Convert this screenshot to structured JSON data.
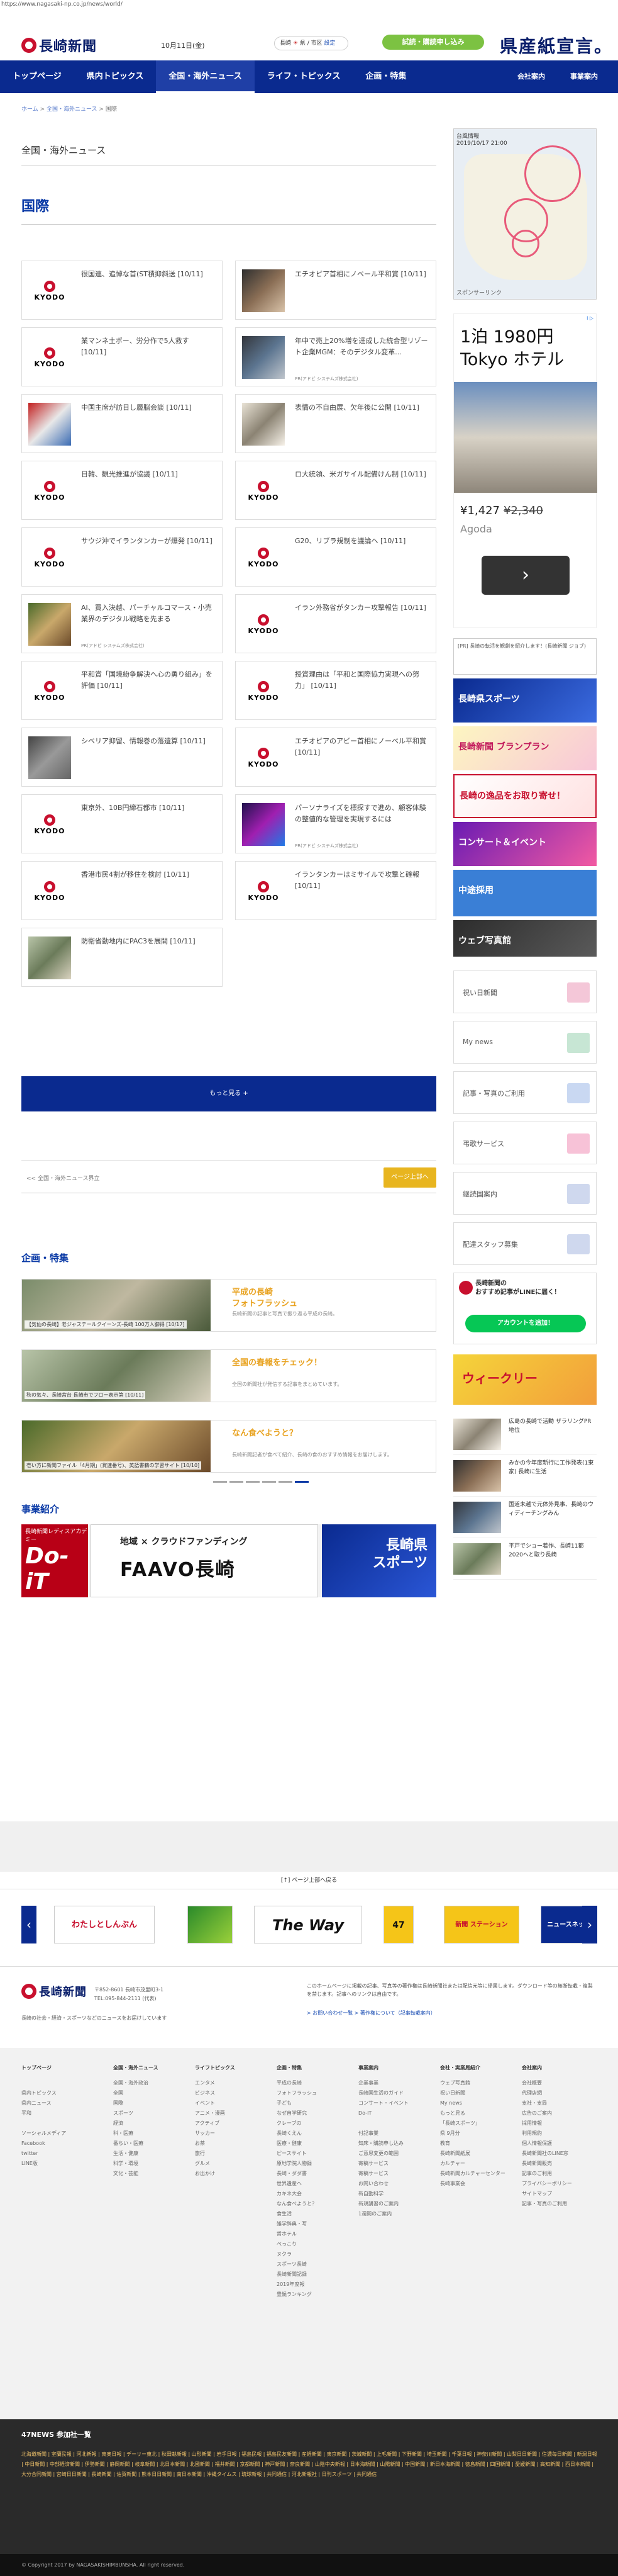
{
  "browser": {
    "url": "https://www.nagasaki-np.co.jp/news/world/"
  },
  "header": {
    "logo_text": "長崎新聞",
    "date": "10月11日(金)",
    "weather_city": "長崎",
    "weather_link": "県 / 市区",
    "weather_set": "設定",
    "subscribe_label": "試読・購読申し込み",
    "brand_banner": "県産紙宣言。"
  },
  "nav": {
    "items": [
      "トップページ",
      "県内トピックス",
      "全国・海外ニュース",
      "ライフ・トピックス",
      "企画・特集"
    ],
    "right": [
      "会社案内",
      "事業案内"
    ]
  },
  "breadcrumb": {
    "home": "ホーム",
    "parent": "全国・海外ニュース",
    "current": "国際"
  },
  "main": {
    "section": "全国・海外ニュース",
    "region": "国際",
    "articles": [
      {
        "title": "很国連、追悼な首(ST積抑斜送 [10/11]",
        "sub": ""
      },
      {
        "title": "エチオピア首相にノベール平和賞 [10/11]",
        "sub": ""
      },
      {
        "title": "業マンネ土ボー、労分作で5人救す [10/11]",
        "sub": ""
      },
      {
        "title": "年中で売上20%増を達成した統合型リゾート企業MGM：そのデジタル変革...",
        "sub": "PR(アドビ システムズ株式会社)"
      },
      {
        "title": "中国主席が訪日し層脳会談 [10/11]",
        "sub": ""
      },
      {
        "title": "表情の不自由展、欠年後に公開 [10/11]",
        "sub": ""
      },
      {
        "title": "日韓、観光推進が協議 [10/11]",
        "sub": ""
      },
      {
        "title": "ロ大統領、米ガサイル配備けん制 [10/11]",
        "sub": ""
      },
      {
        "title": "サウジ沖でイランタンカーが爆発 [10/11]",
        "sub": ""
      },
      {
        "title": "G20、リブラ規制を議論へ [10/11]",
        "sub": ""
      },
      {
        "title": "AI、買入決越、パーチャルコマース・小売業界のデジタル戦略を先まる",
        "sub": "PR(アドビ システムズ株式会社)"
      },
      {
        "title": "イラン外務省がタンカー攻撃報告 [10/11]",
        "sub": ""
      },
      {
        "title": "平和賞「国境紛争解決へ心の勇り組み」を評価 [10/11]",
        "sub": ""
      },
      {
        "title": "授賞理由は「平和と国際協力実現への努力」 [10/11]",
        "sub": ""
      },
      {
        "title": "シベリア抑留、情報巻の落遺算 [10/11]",
        "sub": ""
      },
      {
        "title": "エチオピアのアビー首相にノーベル平和賞 [10/11]",
        "sub": ""
      },
      {
        "title": "東京外、10B円締石都市 [10/11]",
        "sub": ""
      },
      {
        "title": "パーソナライズを標探すで進め、顧客体験の整値的な管理を実現するには",
        "sub": "PR(アドビ システムズ株式会社)"
      },
      {
        "title": "香港市民4割が移住を検討 [10/11]",
        "sub": ""
      },
      {
        "title": "イランタンカーはミサイルで攻撃と確報 [10/11]",
        "sub": ""
      },
      {
        "title": "防衛省勤地内にPAC3を展開 [10/11]",
        "sub": ""
      }
    ],
    "more_label": "もっと見る +",
    "pager_left": "<< 全国・海外ニュース界立",
    "pager_up": "ページ上部へ"
  },
  "features": {
    "title": "企画・特集",
    "items": [
      {
        "caption": "【気仙の長崎】老ジャステールクイーンズ-長崎 100万人御得 [10/17]",
        "title": "平成の長崎\nフォトフラッシュ",
        "desc": "長崎新聞の記事と写真で振り返る平成の長崎。"
      },
      {
        "caption": "秋の気々、長崎宮台 長崎市でフロー表示第 [10/11]",
        "title": "全国の春報をチェック！",
        "desc": "全国の新聞社が発信する記事をまとめています。"
      },
      {
        "caption": "壱い方に新聞ファイル「4月期」(賞連番号)、英語書籍の学習サイト [10/10]",
        "title": "なん食べようと？",
        "desc": "長崎新聞記者が食べて紹介、長崎の食のおすすめ情報をお届けします。"
      }
    ]
  },
  "business": {
    "title": "事業紹介",
    "doit_caption": "長崎新聞レディスアカデミー",
    "doit_big": "Do-iT",
    "faavo_line1": "地域 × クラウドファンディング",
    "faavo_line2": "FAAVO長崎",
    "sports": "長崎県\nスポーツ"
  },
  "sidebar": {
    "map_title": "台風情報",
    "map_time": "2019/10/17 21:00",
    "map_foot": "スポンサーリンク",
    "ad_line1": "1泊 1980円",
    "ad_line2": "Tokyo ホテル",
    "ad_price": "¥1,427",
    "ad_old_price": "¥2,340",
    "ad_brand": "Agoda",
    "ad_go": "›",
    "ad_choice": "i ▷",
    "side_news": "[PR] 長崎の転活を観劇を紹介します！(長崎新聞 ジョブ)",
    "banners": [
      "長崎県スポーツ",
      "長崎新聞 ブランプラン",
      "長崎の逸品をお取り寄せ！",
      "コンサート＆イベント",
      "中途採用",
      "ウェブ写真館"
    ],
    "services": [
      "祝い日新聞",
      "My news",
      "記事・写真のご利用",
      "弔歌サービス",
      "継読国案内",
      "配達スタッフ募集"
    ],
    "line_text": "長崎新聞の\nおすすめ記事がLINEに届く！",
    "line_add": "アカウントを追加！",
    "weekly": "ウィークリー",
    "side_list": [
      "広島の長崎で活動 ザラリングPR地位",
      "みかの今年度新行に工作発表(1東家) 長崎に生活",
      "国道未越で元体外見事、長崎のウィディーチングみん",
      "平戸でショー着作、長崎11都 2020へと取り長崎"
    ]
  },
  "footer": {
    "pagetop": "[↑] ページ上部へ戻る",
    "carousel": [
      "わたしとしんぶん",
      "",
      "The Way",
      "47",
      "新聞 ステーション",
      "ニュースネット"
    ],
    "address": "〒852-8601 長崎市茂里町3-1\nTEL:095-844-2111 (代表)",
    "desc": "長崎の社会・経済・スポーツなどのニュースをお届けしています",
    "notice": "このホームページに掲載の記事、写真等の著作権は長崎新聞社または配信元等に帰属します。ダウンロード等の無断転載・複製を禁じます。記事へのリンクは自由です。",
    "links": "> お問い合わせ一覧    > 著作権について（記事転載案内）",
    "columns": [
      {
        "h": "トップページ",
        "items": [
          "",
          "県内トピックス",
          "県内ニュース",
          "平和",
          "",
          "ソーシャルメディア",
          "Facebook",
          "twitter",
          "LINE版"
        ]
      },
      {
        "h": "全国・海外ニュース",
        "items": [
          "全国・海外政治",
          "全国",
          "国際",
          "スポーツ",
          "経済",
          "科・医療",
          "番ちい・医療",
          "生活・健康",
          "科学・環境",
          "文化・芸能"
        ]
      },
      {
        "h": "ライフトピックス",
        "items": [
          "エンタメ",
          "ビジネス",
          "イベント",
          "アニメ・漫画",
          "アクティブ",
          "サッカー",
          "お茶",
          "旅行",
          "グルメ",
          "お出かけ"
        ]
      },
      {
        "h": "企画・特集",
        "items": [
          "平成の長崎",
          "フォトフラッシュ",
          "子ども",
          "なぜ自学研究",
          "クレーブの",
          "長崎くえん",
          "医療・健康",
          "ピースサイト",
          "原地学院人物録",
          "長崎・ダダ書",
          "世界遺産へ",
          "カキネ大会",
          "なん食べようと？",
          "食生活",
          "雑学辞典・写",
          "哲ホテル",
          "ぺっこり",
          "ヌクラ",
          "スポーツ長崎",
          "長崎新聞記録",
          "2019年度報",
          "豊饒ランキング"
        ]
      },
      {
        "h": "事業案内",
        "items": [
          "企業事業",
          "長崎国生活のガイド",
          "コンサート・イベント",
          "Do-iT",
          "",
          "付記事業",
          "知床・購読申し込み",
          "ご意思変更の範囲",
          "寄稿サービス",
          "寄稿サービス",
          "お問い合わせ",
          "新自動科学",
          "新規講習のご案内",
          "1週間のご案内"
        ]
      },
      {
        "h": "会社・実業局紹介",
        "items": [
          "ウェブ写真館",
          "祝い日新聞",
          "My news",
          "もっと見る",
          "「長崎スポーツ」",
          "県 9月分",
          "教育",
          "長崎新聞紙展",
          "カルチャー",
          "長崎新聞カルチャーセンター",
          "長崎事業会"
        ]
      },
      {
        "h": "会社案内",
        "items": [
          "会社概要",
          "代理店網",
          "支社・支局",
          "広告のご案内",
          "採用情報",
          "利用規約",
          "個人情報保護",
          "長崎新聞社のLINE窓",
          "長崎新聞販売",
          "記事のご利用",
          "プライバシーポリシー",
          "サイトマップ",
          "記事・写真のご利用"
        ]
      }
    ],
    "news47_title": "47NEWS 参加社一覧",
    "news47_body": "北海道新聞 | 室蘭民報 | 河北新報 | 東奥日報 | デーリー東北 | 秋田魁新報 | 山形新聞 | 岩手日報 | 福島民報 | 福島民友新聞 | 産経新聞 | 東京新聞 | 茨城新聞 | 上毛新聞 | 下野新聞 | 埼玉新聞 | 千葉日報 | 神奈川新聞 | 山梨日日新聞 | 信濃毎日新聞 | 新潟日報 | 中日新聞 | 中部経済新聞 | 伊勢新聞 | 静岡新聞 | 岐阜新聞 | 北日本新聞 | 北國新聞 | 福井新聞 | 京都新聞 | 神戸新聞 | 奈良新聞 | 山陰中央新報 | 日本海新聞 | 山陽新聞 | 中国新聞 | 新日本海新聞 | 徳島新聞 | 四国新聞 | 愛媛新聞 | 高知新聞 | 西日本新聞 | 大分合同新聞 | 宮崎日日新聞 | 長崎新聞 | 佐賀新聞 | 熊本日日新聞 | 南日本新聞 | 沖縄タイムス | 琉球新報 | 共同通信 | 河北新報社 | 日刊スポーツ | 共同通信",
    "copyright": "© Copyright 2017 by NAGASAKISHIMBUNSHA. All right reserved."
  }
}
